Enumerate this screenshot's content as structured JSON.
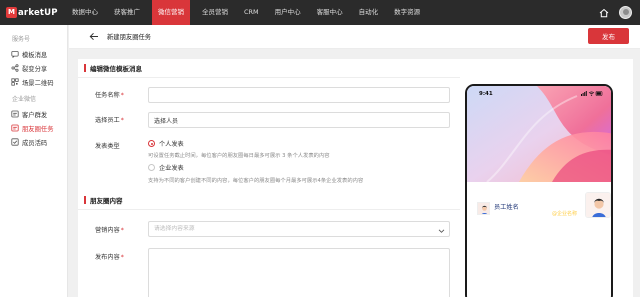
{
  "brand": {
    "logo_letter": "M",
    "logo_text": "arketUP"
  },
  "topnav": {
    "items": [
      {
        "label": "数据中心"
      },
      {
        "label": "获客推广"
      },
      {
        "label": "微信营销"
      },
      {
        "label": "全员营销"
      },
      {
        "label": "CRM"
      },
      {
        "label": "用户中心"
      },
      {
        "label": "客服中心"
      },
      {
        "label": "自动化"
      },
      {
        "label": "数字资源"
      }
    ],
    "active_index": 2,
    "right_icons": [
      "home-icon",
      "avatar"
    ]
  },
  "sidebar": {
    "groups": [
      {
        "title": "服务号",
        "items": [
          {
            "label": "模板消息",
            "icon": "message-icon"
          },
          {
            "label": "裂变分享",
            "icon": "share-icon"
          },
          {
            "label": "场景二维码",
            "icon": "qrcode-icon"
          }
        ]
      },
      {
        "title": "企业微信",
        "items": [
          {
            "label": "客户群发",
            "icon": "group-icon"
          },
          {
            "label": "朋友圈任务",
            "icon": "moments-icon"
          },
          {
            "label": "成员活码",
            "icon": "member-code-icon"
          }
        ]
      }
    ],
    "active_label": "朋友圈任务"
  },
  "header": {
    "title": "新建朋友圈任务",
    "publish_label": "发布"
  },
  "form": {
    "section1_title": "编辑微信模板消息",
    "task_name_label": "任务名称",
    "task_name_value": "",
    "employee_label": "选择员工",
    "employee_value": "选择人员",
    "send_type_label": "发表类型",
    "option_personal": "个人发表",
    "option_personal_hint": "可设置任务截止时间，每位客户的朋友圈每日最多可展示 3 条个人发表的内容",
    "option_enterprise": "企业发表",
    "option_enterprise_hint": "支持为不同的客户创建不同的内容，每位客户的朋友圈每个月最多可展示4条企业发表的内容",
    "selected_option": "个人发表",
    "required_mark": "*",
    "section2_title": "朋友圈内容",
    "marketing_label": "营销内容",
    "marketing_placeholder": "请选择内容来源",
    "publish_content_label": "发布内容"
  },
  "preview": {
    "time": "9:41",
    "cover_name": "员工姓名",
    "cover_company": "@企业名称",
    "post_name": "员工姓名"
  },
  "colors": {
    "accent": "#d9363a",
    "nav_bg": "#2b2b2b",
    "link_blue": "#243a7a",
    "company_yellow": "#ffcf4a"
  }
}
